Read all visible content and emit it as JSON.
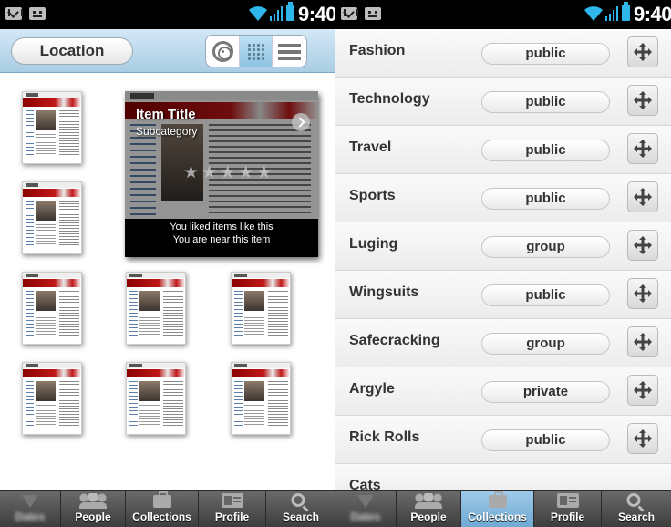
{
  "status": {
    "time": "9:40"
  },
  "left": {
    "location_label": "Location",
    "view_modes": [
      "target-view",
      "grid-view",
      "list-view"
    ],
    "active_view": "grid-view",
    "featured": {
      "title": "Item Title",
      "subtitle": "Subcategory",
      "rating_max": 5,
      "rating": 0,
      "info_line1": "You liked items like this",
      "info_line2": "You are near this item"
    },
    "tabs": [
      {
        "label": "Dates",
        "icon": "triangle-icon",
        "active": false,
        "blurred": true
      },
      {
        "label": "People",
        "icon": "people-icon",
        "active": false,
        "blurred": false
      },
      {
        "label": "Collections",
        "icon": "briefcase-icon",
        "active": false,
        "blurred": false
      },
      {
        "label": "Profile",
        "icon": "profile-card-icon",
        "active": false,
        "blurred": false
      },
      {
        "label": "Search",
        "icon": "search-icon",
        "active": false,
        "blurred": false
      }
    ]
  },
  "right": {
    "collections": [
      {
        "name": "Fashion",
        "visibility": "public"
      },
      {
        "name": "Technology",
        "visibility": "public"
      },
      {
        "name": "Travel",
        "visibility": "public"
      },
      {
        "name": "Sports",
        "visibility": "public"
      },
      {
        "name": "Luging",
        "visibility": "group"
      },
      {
        "name": "Wingsuits",
        "visibility": "public"
      },
      {
        "name": "Safecracking",
        "visibility": "group"
      },
      {
        "name": "Argyle",
        "visibility": "private"
      },
      {
        "name": "Rick Rolls",
        "visibility": "public"
      },
      {
        "name": "Cats",
        "visibility": ""
      }
    ],
    "tabs": [
      {
        "label": "Dates",
        "icon": "triangle-icon",
        "active": false,
        "blurred": true
      },
      {
        "label": "People",
        "icon": "people-icon",
        "active": false,
        "blurred": false
      },
      {
        "label": "Collections",
        "icon": "briefcase-icon",
        "active": true,
        "blurred": false
      },
      {
        "label": "Profile",
        "icon": "profile-card-icon",
        "active": false,
        "blurred": false
      },
      {
        "label": "Search",
        "icon": "search-icon",
        "active": false,
        "blurred": false
      }
    ]
  },
  "colors": {
    "toolbar_top": "#d3e8f6",
    "toolbar_bottom": "#a9cde4",
    "active_tab": "#8ec3e2",
    "battery": "#2fb7ec"
  }
}
